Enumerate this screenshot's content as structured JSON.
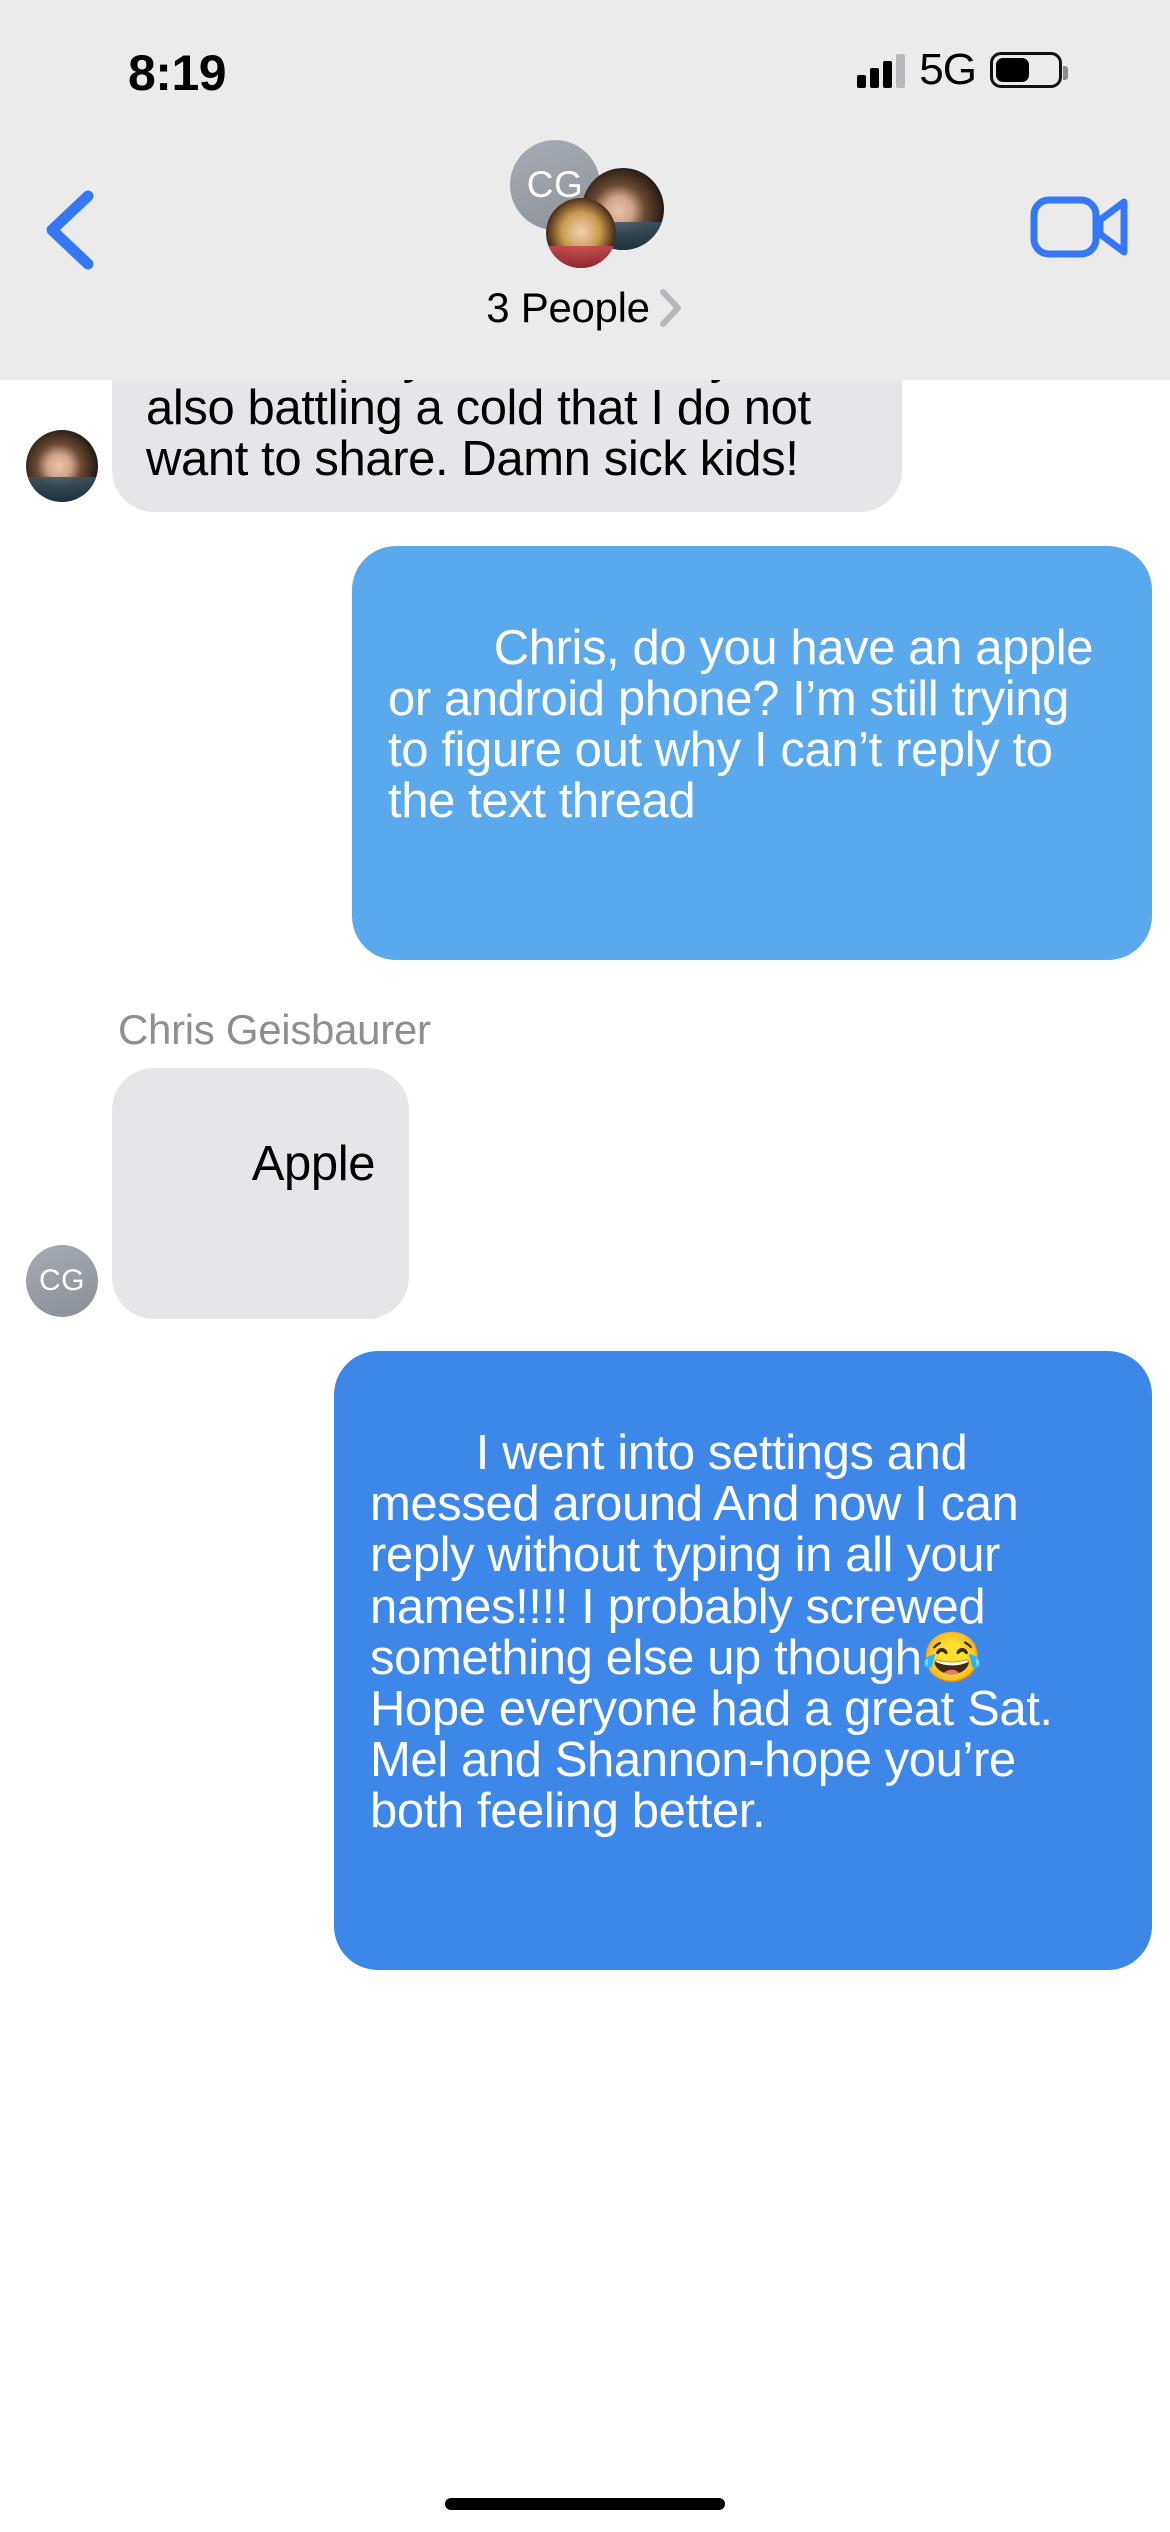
{
  "status_bar": {
    "time": "8:19",
    "network": "5G",
    "signal_icon": "cellular-bars-icon",
    "battery_icon": "battery-icon",
    "battery_level_percent": 55
  },
  "header": {
    "back_icon": "chevron-left-icon",
    "facetime_icon": "video-camera-icon",
    "title": "3 People",
    "disclosure_icon": "chevron-right-icon",
    "avatars": [
      {
        "type": "initials",
        "initials": "CG",
        "name": "avatar-chris-geisbaurer"
      },
      {
        "type": "photo",
        "name": "avatar-photo-dark-hair"
      },
      {
        "type": "photo",
        "name": "avatar-photo-curly-hair"
      }
    ],
    "background_color": "#ebebeb"
  },
  "colors": {
    "bubble_gray": "#e6e6e8",
    "bubble_blue_light": "#5aa9ec",
    "bubble_blue": "#3d87e8",
    "accent_blue": "#3478f6",
    "sender_name_gray": "#8e8e93"
  },
  "messages": [
    {
      "id": "msg-1",
      "side": "incoming",
      "bubble_style": "gray",
      "avatar": "photo",
      "clipped_top": true,
      "text": "baseball players. I am sorry. I am also battling a cold that I do not want to share. Damn sick kids!"
    },
    {
      "id": "msg-2",
      "side": "outgoing",
      "bubble_style": "blue-light",
      "text": "Chris, do you have an apple or android phone? I’m still trying to figure out why I can’t reply to the text thread"
    },
    {
      "id": "msg-3",
      "side": "incoming",
      "bubble_style": "gray",
      "avatar": "initials",
      "avatar_initials": "CG",
      "sender_name": "Chris Geisbaurer",
      "text": "Apple"
    },
    {
      "id": "msg-4",
      "side": "outgoing",
      "bubble_style": "blue",
      "text": "I went into settings and messed around And now I can reply without typing in all your names!!!! I probably screwed something else up though😂\nHope everyone had a great Sat.\nMel and Shannon-hope you’re both feeling better."
    }
  ],
  "home_indicator": "home-indicator"
}
